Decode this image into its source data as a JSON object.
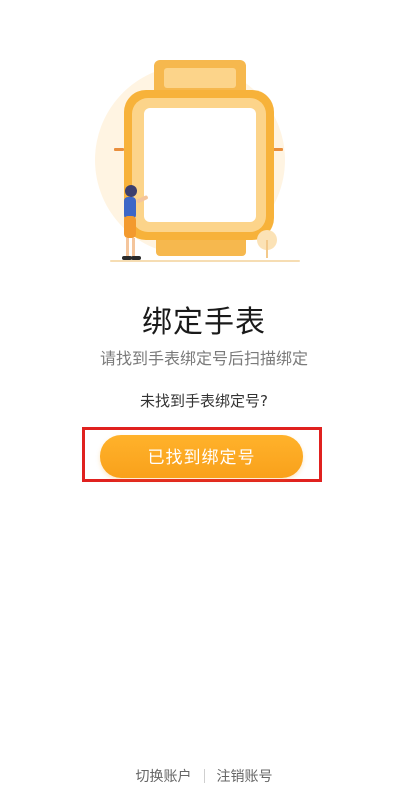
{
  "title": "绑定手表",
  "subtitle": "请找到手表绑定号后扫描绑定",
  "hint_link": "未找到手表绑定号?",
  "primary_button": "已找到绑定号",
  "footer": {
    "switch_account": "切换账户",
    "logout_account": "注销账号"
  },
  "colors": {
    "accent": "#f9a11b",
    "highlight_border": "#e0211f",
    "subtitle": "#7a7a7a"
  },
  "illustration": {
    "icon": "watch-illustration"
  }
}
